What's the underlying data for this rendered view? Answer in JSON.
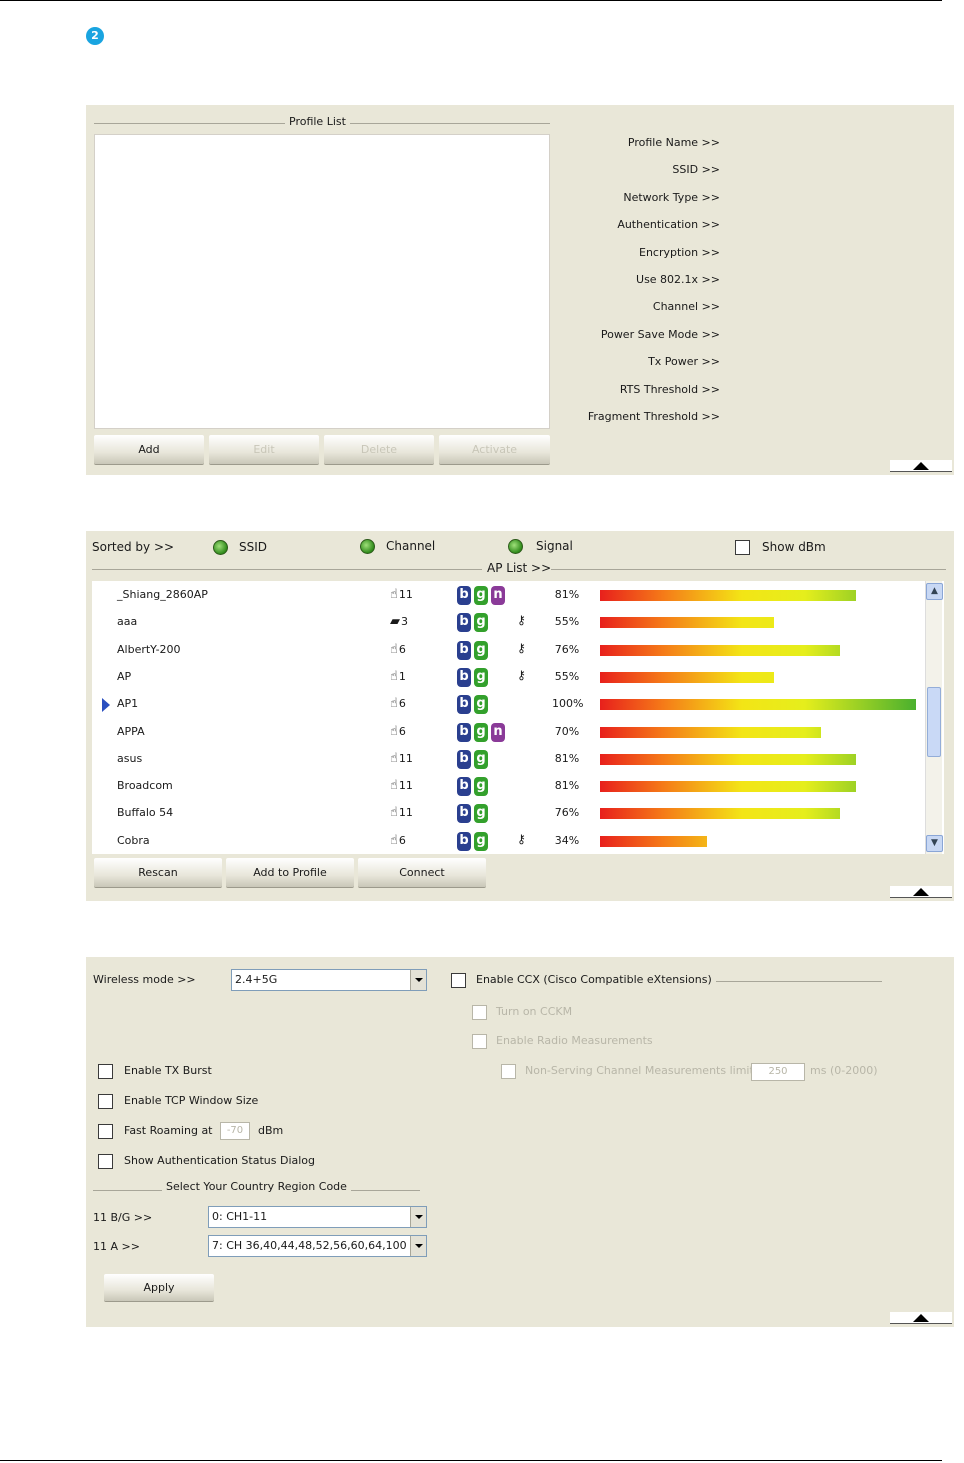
{
  "step_badge": "2",
  "profile_panel": {
    "fieldset_title": "Profile List",
    "buttons": {
      "add": "Add",
      "edit": "Edit",
      "delete": "Delete",
      "activate": "Activate"
    },
    "labels": [
      "Profile Name >>",
      "SSID >>",
      "Network Type >>",
      "Authentication >>",
      "Encryption >>",
      "Use 802.1x >>",
      "Channel >>",
      "Power Save Mode >>",
      "Tx Power >>",
      "RTS Threshold >>",
      "Fragment Threshold >>"
    ]
  },
  "ap_panel": {
    "sorted_by_label": "Sorted by >>",
    "sort_ssid": "SSID",
    "sort_channel": "Channel",
    "sort_signal": "Signal",
    "show_dbm": "Show dBm",
    "ap_list_title": "AP List >>",
    "rows": [
      {
        "ssid": "_Shiang_2860AP",
        "channel": "11",
        "b": "b",
        "g": "g",
        "n": "n",
        "lock": false,
        "signal": "81%",
        "signal_value": 81,
        "selected": false,
        "icon": "hand-antenna-icon"
      },
      {
        "ssid": "aaa",
        "channel": "3",
        "b": "b",
        "g": "g",
        "n": "",
        "lock": true,
        "signal": "55%",
        "signal_value": 55,
        "selected": false,
        "icon": "router-icon"
      },
      {
        "ssid": "AlbertY-200",
        "channel": "6",
        "b": "b",
        "g": "g",
        "n": "",
        "lock": true,
        "signal": "76%",
        "signal_value": 76,
        "selected": false,
        "icon": "hand-antenna-icon"
      },
      {
        "ssid": "AP",
        "channel": "1",
        "b": "b",
        "g": "g",
        "n": "",
        "lock": true,
        "signal": "55%",
        "signal_value": 55,
        "selected": false,
        "icon": "hand-antenna-icon"
      },
      {
        "ssid": "AP1",
        "channel": "6",
        "b": "b",
        "g": "g",
        "n": "",
        "lock": false,
        "signal": "100%",
        "signal_value": 100,
        "selected": true,
        "icon": "hand-antenna-icon"
      },
      {
        "ssid": "APPA",
        "channel": "6",
        "b": "b",
        "g": "g",
        "n": "n",
        "lock": false,
        "signal": "70%",
        "signal_value": 70,
        "selected": false,
        "icon": "hand-antenna-icon"
      },
      {
        "ssid": "asus",
        "channel": "11",
        "b": "b",
        "g": "g",
        "n": "",
        "lock": false,
        "signal": "81%",
        "signal_value": 81,
        "selected": false,
        "icon": "hand-antenna-icon"
      },
      {
        "ssid": "Broadcom",
        "channel": "11",
        "b": "b",
        "g": "g",
        "n": "",
        "lock": false,
        "signal": "81%",
        "signal_value": 81,
        "selected": false,
        "icon": "hand-antenna-icon"
      },
      {
        "ssid": "Buffalo 54",
        "channel": "11",
        "b": "b",
        "g": "g",
        "n": "",
        "lock": false,
        "signal": "76%",
        "signal_value": 76,
        "selected": false,
        "icon": "hand-antenna-icon"
      },
      {
        "ssid": "Cobra",
        "channel": "6",
        "b": "b",
        "g": "g",
        "n": "",
        "lock": true,
        "signal": "34%",
        "signal_value": 34,
        "selected": false,
        "icon": "hand-antenna-icon"
      }
    ],
    "buttons": {
      "rescan": "Rescan",
      "add_to_profile": "Add to Profile",
      "connect": "Connect"
    }
  },
  "advanced_panel": {
    "wireless_mode_label": "Wireless mode >>",
    "wireless_mode_value": "2.4+5G",
    "enable_ccx": "Enable CCX (Cisco Compatible eXtensions)",
    "turn_on_cckm": "Turn on CCKM",
    "enable_radio_measurements": "Enable Radio Measurements",
    "non_serving_label": "Non-Serving Channel Measurements limit",
    "non_serving_value": "250",
    "non_serving_unit": "ms (0-2000)",
    "enable_tx_burst": "Enable TX Burst",
    "enable_tcp_window": "Enable TCP Window Size",
    "fast_roaming_label": "Fast Roaming at",
    "fast_roaming_value": "-70",
    "fast_roaming_unit": "dBm",
    "show_auth_status": "Show Authentication Status Dialog",
    "country_region_title": "Select Your Country Region Code",
    "bg_label": "11 B/G >>",
    "bg_value": "0: CH1-11",
    "a_label": "11 A >>",
    "a_value": "7: CH 36,40,44,48,52,56,60,64,100",
    "apply": "Apply"
  }
}
